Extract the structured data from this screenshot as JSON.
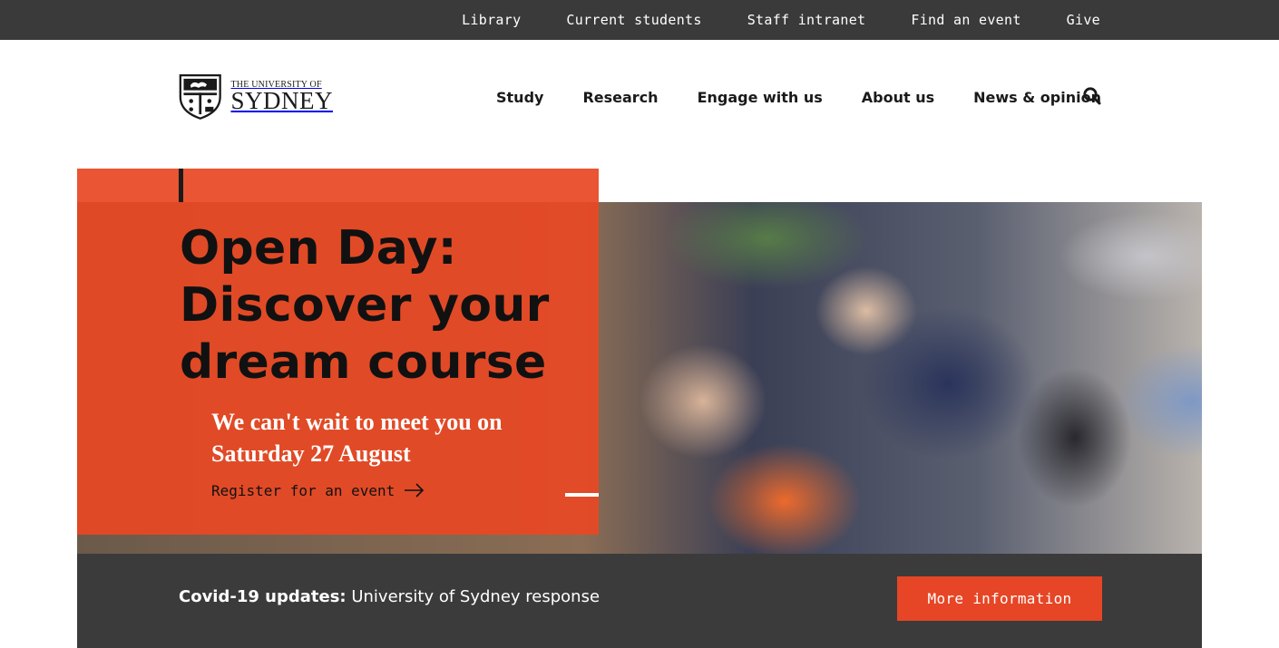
{
  "utility_nav": {
    "items": [
      "Library",
      "Current students",
      "Staff intranet",
      "Find an event",
      "Give"
    ]
  },
  "logo": {
    "line1": "THE UNIVERSITY OF",
    "line2": "SYDNEY"
  },
  "main_nav": {
    "items": [
      "Study",
      "Research",
      "Engage with us",
      "About us",
      "News & opinion"
    ],
    "search_icon": "search-icon"
  },
  "hero": {
    "title": "Open Day: Discover your dream course",
    "subtitle": "We can't wait to meet you on Saturday 27 August",
    "link_label": "Register for an event",
    "link_icon": "arrow-right-icon",
    "card_color": "#e84823"
  },
  "covid": {
    "label_bold": "Covid-19 updates:",
    "label_text": " University of Sydney response",
    "button_label": "More information",
    "button_color": "#e64626"
  },
  "colors": {
    "utility_bar": "#3a3a3a",
    "banner": "#3b3b3b",
    "accent": "#e64626"
  }
}
